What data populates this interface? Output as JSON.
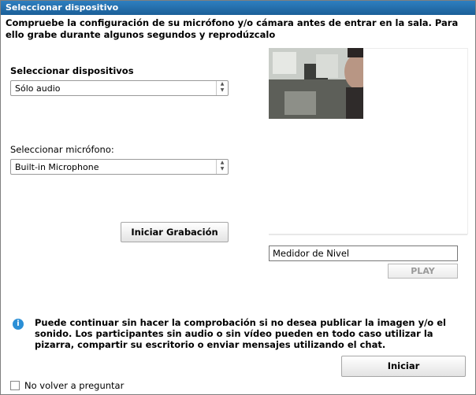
{
  "window": {
    "title": "Seleccionar dispositivo"
  },
  "intro": {
    "text": "Compruebe la configuración de su micrófono y/o cámara antes de entrar en la sala. Para ello grabe durante algunos segundos y reprodúzcalo"
  },
  "devices": {
    "heading": "Seleccionar dispositivos",
    "selected": "Sólo audio"
  },
  "microphone": {
    "label": "Seleccionar micrófono:",
    "selected": "Built-in Microphone"
  },
  "buttons": {
    "record": "Iniciar Grabación",
    "play": "PLAY",
    "start": "Iniciar"
  },
  "meter": {
    "label": "Medidor de Nivel"
  },
  "info": {
    "text": "Puede continuar sin hacer la comprobación si no desea publicar la imagen y/o el sonido. Los participantes sin audio o sin vídeo pueden en todo caso utilizar la pizarra, compartir su escritorio o enviar mensajes utilizando el chat."
  },
  "footer": {
    "checkbox_label": "No volver a preguntar"
  },
  "colors": {
    "titlebar": "#1f67a4",
    "info_icon": "#2b8fd6"
  }
}
